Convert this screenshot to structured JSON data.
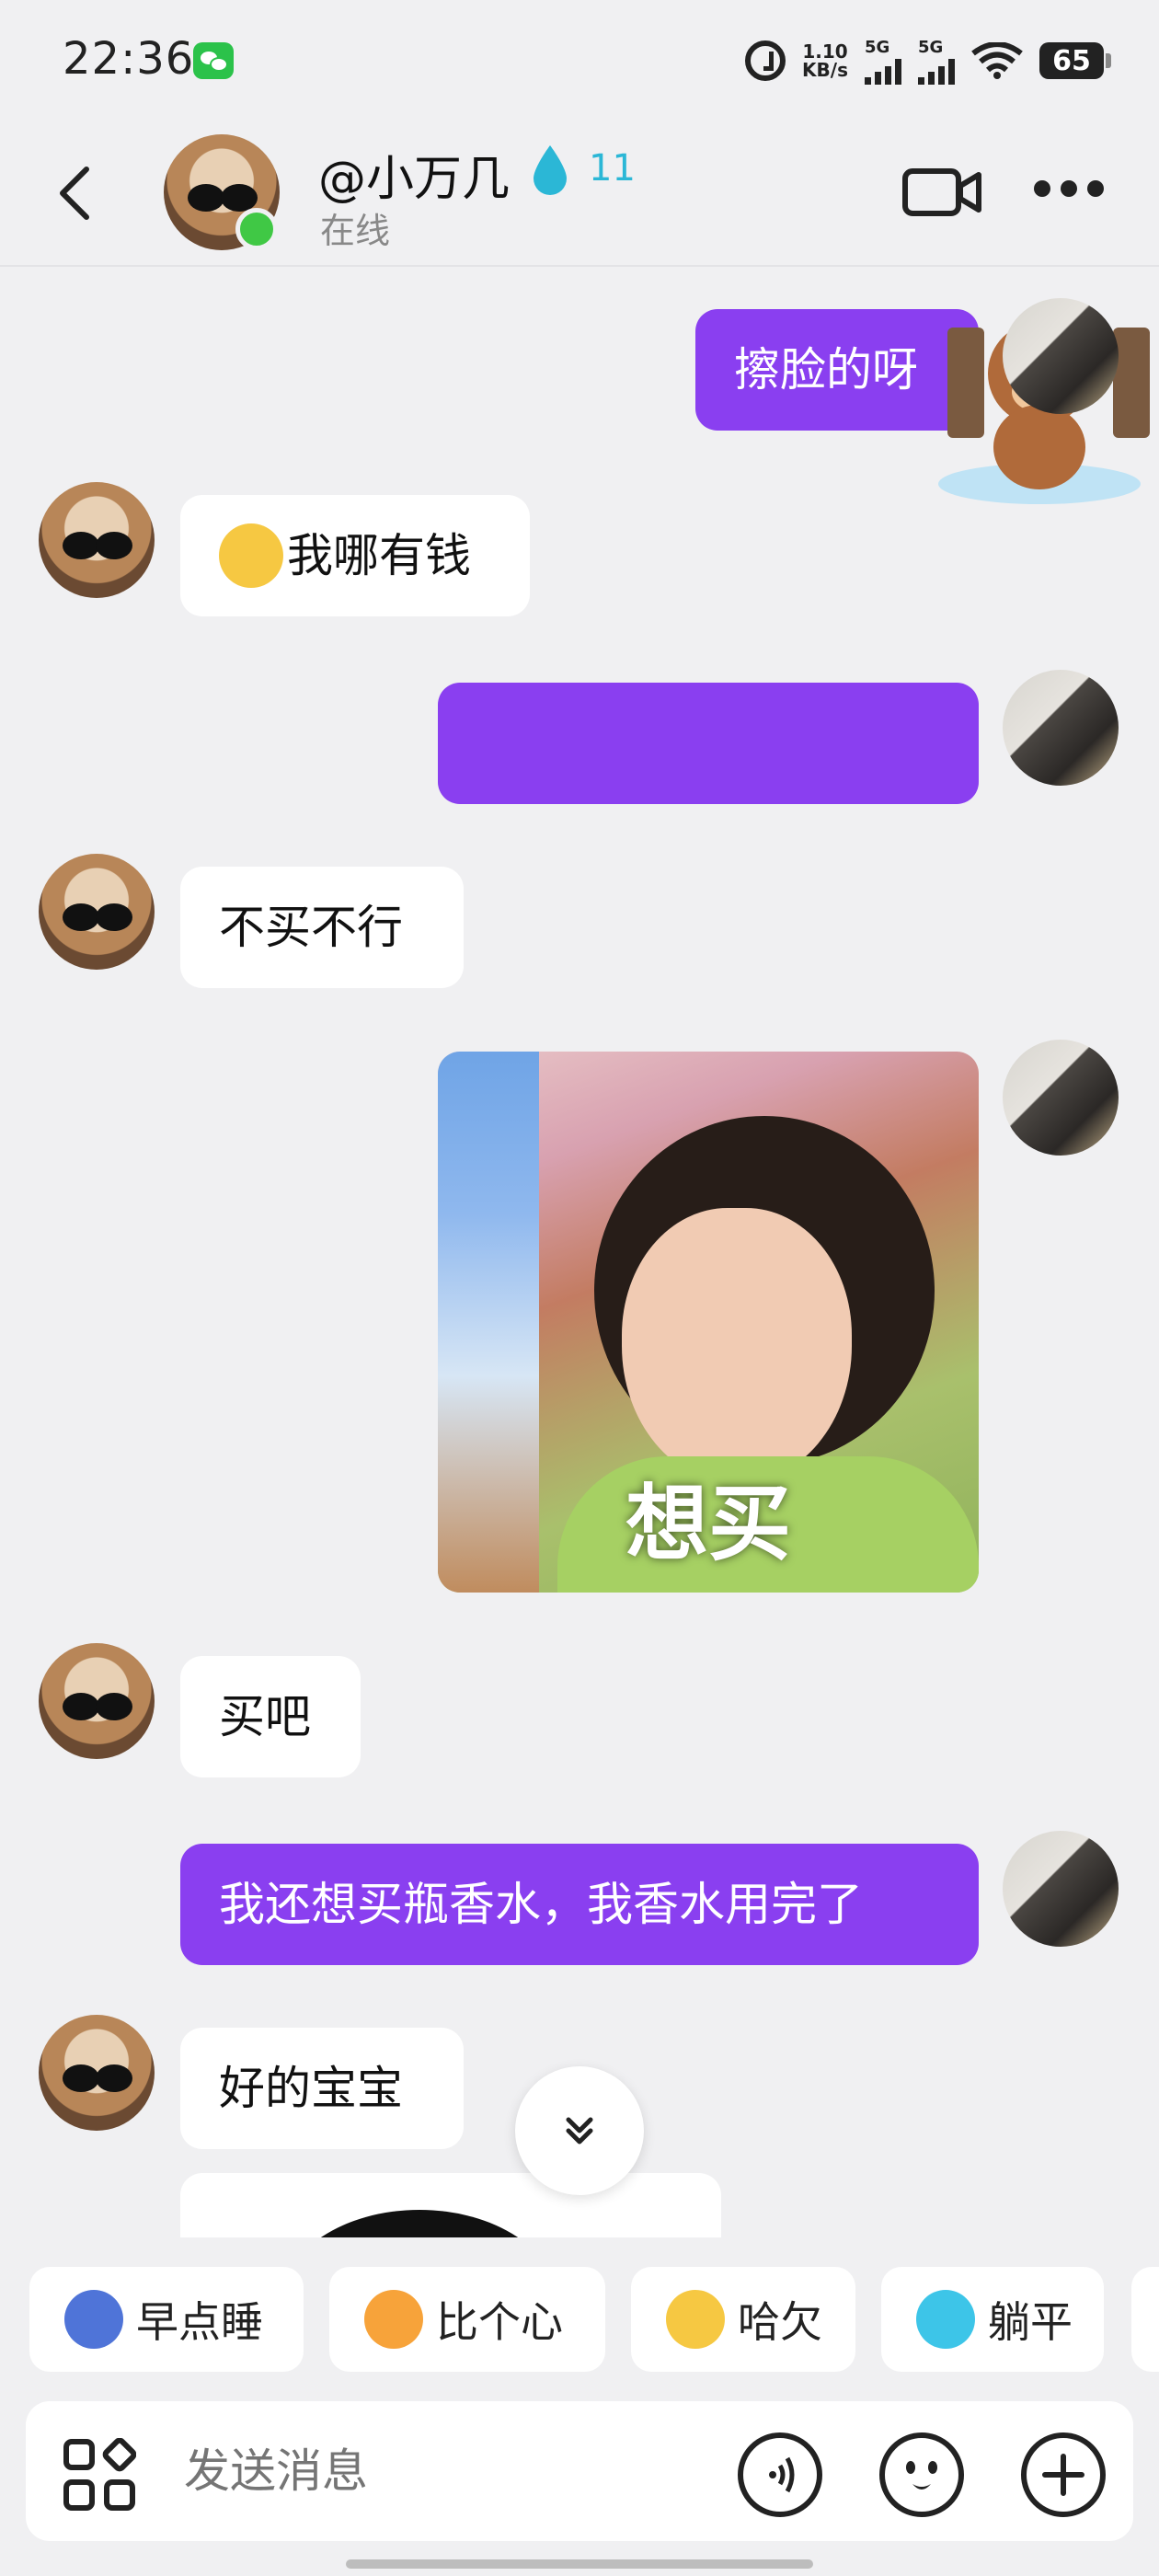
{
  "status_bar": {
    "time": "22:36",
    "speed_value": "1.10",
    "speed_unit": "KB/s",
    "sim1": "5G",
    "sim2": "5G",
    "battery": "65"
  },
  "header": {
    "contact_name": "@小万几",
    "flame_count": "11",
    "status": "在线"
  },
  "messages": [
    {
      "side": "out",
      "text": "擦脸的呀"
    },
    {
      "side": "in",
      "text": "我哪有钱"
    },
    {
      "side": "out",
      "text": ""
    },
    {
      "side": "in",
      "text": "不买不行"
    },
    {
      "side": "out",
      "type": "image",
      "caption": "想买"
    },
    {
      "side": "in",
      "text": "买吧"
    },
    {
      "side": "out",
      "text": "我还想买瓶香水，我香水用完了"
    },
    {
      "side": "in",
      "text": "好的宝宝"
    }
  ],
  "quick_replies": [
    "早点睡",
    "比个心",
    "哈欠",
    "躺平"
  ],
  "input": {
    "placeholder": "发送消息"
  },
  "colors": {
    "accent": "#8a3ff0",
    "online": "#40c845",
    "flame": "#2bb7d6"
  }
}
